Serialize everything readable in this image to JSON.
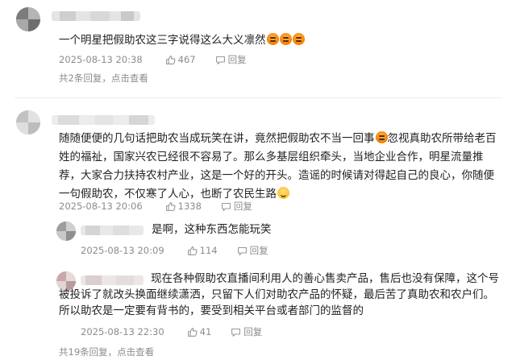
{
  "comments": [
    {
      "text": "一个明星把假助农这三字说得这么大义凛然",
      "emoji": [
        "angry-face-emoji",
        "angry-face-emoji",
        "angry-face-emoji"
      ],
      "date": "2025-08-13 20:38",
      "likes": "467",
      "reply_label": "回复",
      "replies_count_text": "共2条回复，",
      "replies_link_text": "点击查看"
    },
    {
      "text_part1": "随随便便的几句话把助农当成玩笑在讲，竟然把假助农不当一回事",
      "text_part2": "忽视真助农所带给老百姓的福祉，国家兴农已经很不容易了。那么多基层组织牵头，当地企业合作，明星流量推荐，大家合力扶持农村产业，这是一个好的开头。造谣的时候请对得起自己的良心，你随便一句假助农，不仅寒了人心，也断了农民生路",
      "date": "2025-08-13 20:06",
      "likes": "1338",
      "reply_label": "回复",
      "replies_count_text": "共19条回复，",
      "replies_link_text": "点击查看",
      "replies": [
        {
          "text": "是啊，这种东西怎能玩笑",
          "date": "2025-08-13 20:09",
          "likes": "114",
          "reply_label": "回复"
        },
        {
          "text": "现在各种假助农直播间利用人的善心售卖产品，售后也没有保障，这个号被投诉了就改头换面继续潇洒，只留下人们对助农产品的怀疑，最后苦了真助农和农户们。所以助农是一定要有背书的，要受到相关平台或者部门的监督的",
          "date": "2025-08-13 22:30",
          "likes": "41",
          "reply_label": "回复"
        }
      ]
    }
  ],
  "colors": {
    "text": "#222222",
    "meta": "#8c8c8c",
    "divider": "#ececec"
  }
}
